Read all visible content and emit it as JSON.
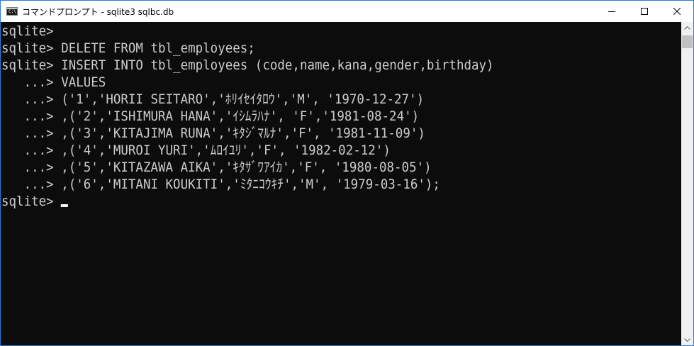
{
  "window": {
    "title": "コマンドプロンプト - sqlite3  sqlbc.db",
    "icon": "console-icon",
    "icon_text": "C:\\",
    "controls": [
      "minimize-icon",
      "maximize-icon",
      "close-icon"
    ]
  },
  "console": {
    "lines": [
      "sqlite>",
      "sqlite> DELETE FROM tbl_employees;",
      "sqlite> INSERT INTO tbl_employees (code,name,kana,gender,birthday)",
      "   ...> VALUES",
      "   ...> ('1','HORII SEITARO','ﾎﾘｲｾｲﾀﾛｳ','M', '1970-12-27')",
      "   ...> ,('2','ISHIMURA HANA','ｲｼﾑﾗﾊﾅ', 'F','1981-08-24')",
      "   ...> ,('3','KITAJIMA RUNA','ｷﾀｼﾞﾏﾙﾅ','F', '1981-11-09')",
      "   ...> ,('4','MUROI YURI','ﾑﾛｲﾕﾘ','F', '1982-02-12')",
      "   ...> ,('5','KITAZAWA AIKA','ｷﾀｻﾞﾜｱｲｶ','F', '1980-08-05')",
      "   ...> ,('6','MITANI KOUKITI','ﾐﾀﾆｺｳｷﾁ','M', '1979-03-16');"
    ],
    "prompt": "sqlite>"
  },
  "colors": {
    "background": "#0c0c0c",
    "text": "#cccccc",
    "titlebar": "#ffffff",
    "border": "#2b7bd6"
  }
}
